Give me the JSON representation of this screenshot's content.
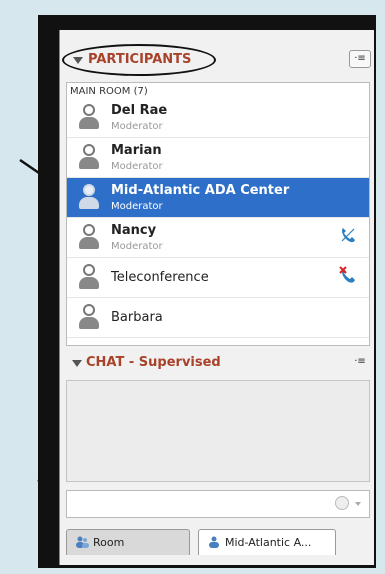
{
  "participants": {
    "title": "PARTICIPANTS",
    "menu_icon": "list-menu-icon",
    "room_label": "MAIN ROOM (7)",
    "items": [
      {
        "name": "Del Rae",
        "role": "Moderator",
        "status_icon": ""
      },
      {
        "name": "Marian",
        "role": "Moderator",
        "status_icon": ""
      },
      {
        "name": "Mid-Atlantic ADA Center",
        "role": "Moderator",
        "status_icon": "",
        "selected": true
      },
      {
        "name": "Nancy",
        "role": "Moderator",
        "status_icon": "phone-connected-icon"
      },
      {
        "name": "Teleconference",
        "role": "",
        "status_icon": "phone-disconnected-icon"
      },
      {
        "name": "Barbara",
        "role": "",
        "status_icon": ""
      }
    ]
  },
  "chat": {
    "title": "CHAT - Supervised",
    "menu_icon": "list-menu-icon",
    "input_value": "",
    "emoji_icon": "smiley-icon"
  },
  "tabs": [
    {
      "label": "Room",
      "icon": "people-icon",
      "active": false
    },
    {
      "label": "Mid-Atlantic A...",
      "icon": "person-icon",
      "active": true
    }
  ],
  "colors": {
    "selection": "#2e6fc9",
    "header_text": "#a8422a",
    "background": "#d6e8ee"
  }
}
